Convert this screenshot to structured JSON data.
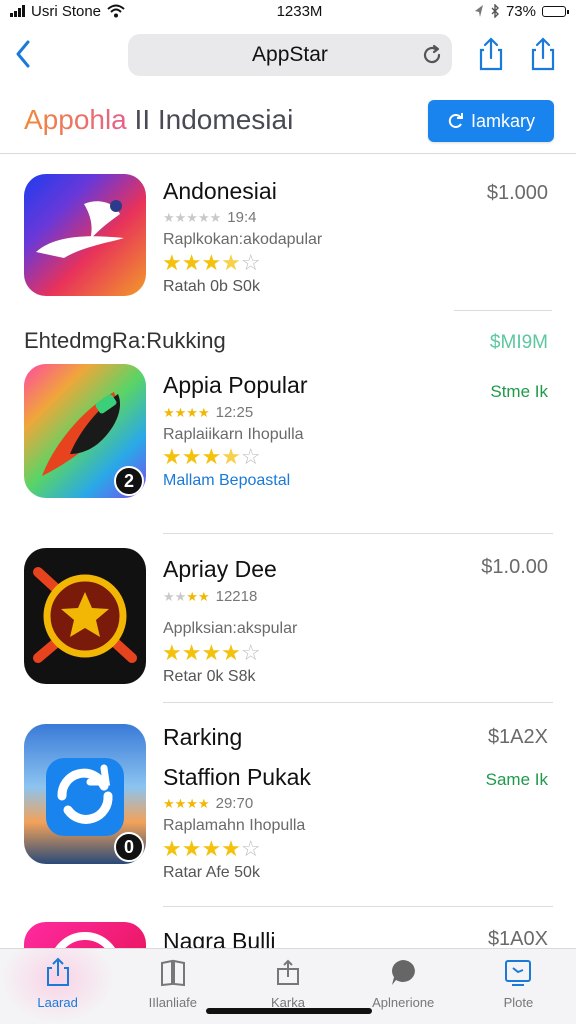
{
  "status_bar": {
    "carrier": "Usri Stone",
    "time": "1233M",
    "battery_percent": "73%"
  },
  "nav": {
    "url_title": "AppStar"
  },
  "header": {
    "title_accent": "Appohla",
    "title_rest": " II Indomesiai",
    "cta_label": "Iamkary"
  },
  "section": {
    "heading": "EhtedmgRa:Rukking",
    "price_hint": "$MI9M"
  },
  "apps": [
    {
      "name": "Andonesiai",
      "rating_count": "19:4",
      "category": "Raplkokan:akodapular",
      "stars": 3.5,
      "downloads": "Ratah 0b S0k",
      "price": "$1.000"
    },
    {
      "name": "Appia Popular",
      "rating_count": "12:25",
      "category": "Raplaiikarn Ihopulla",
      "stars": 3.5,
      "downloads": "Mallam Bepoastal",
      "price": "Stme Ik",
      "rank": "2"
    },
    {
      "name": "Apriay Dee",
      "rating_count": "12218",
      "category": "Applksian:akspular",
      "stars": 4,
      "downloads": "Retar 0k S8k",
      "price": "$1.0.00"
    },
    {
      "name": "Rarking",
      "subtitle": "Staffion Pukak",
      "rating_count": "29:70",
      "category": "Raplamahn Ihopulla",
      "stars": 4,
      "downloads": "Ratar Afe 50k",
      "price_top": "$1A2X",
      "price": "Same Ik",
      "rank": "0"
    },
    {
      "name": "Nagra Bulli",
      "price": "$1A0X"
    }
  ],
  "tabs": [
    {
      "label": "Laarad",
      "icon": "share-icon",
      "active": true
    },
    {
      "label": "IIlanliafe",
      "icon": "book-icon"
    },
    {
      "label": "Karka",
      "icon": "tray-icon"
    },
    {
      "label": "Aplnerione",
      "icon": "chat-bubble-icon"
    },
    {
      "label": "Plote",
      "icon": "screen-icon"
    }
  ]
}
